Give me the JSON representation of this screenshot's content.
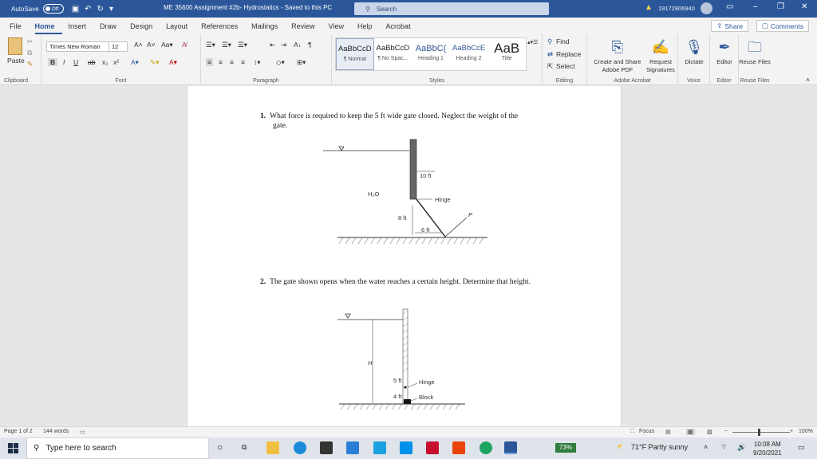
{
  "titlebar": {
    "autosave_label": "AutoSave",
    "autosave_state": "Off",
    "doc_title": "ME 35600 Assignment #2b- Hydrostatics  -  Saved to this PC",
    "search_placeholder": "Search",
    "phone": "19172806940",
    "accent": "#2b579a"
  },
  "menu": {
    "tabs": [
      "File",
      "Home",
      "Insert",
      "Draw",
      "Design",
      "Layout",
      "References",
      "Mailings",
      "Review",
      "View",
      "Help",
      "Acrobat"
    ],
    "active": "Home",
    "share": "Share",
    "comments": "Comments"
  },
  "ribbon": {
    "clipboard": {
      "paste": "Paste",
      "label": "Clipboard"
    },
    "font": {
      "family": "Times New Roman",
      "size": "12",
      "label": "Font"
    },
    "paragraph": {
      "label": "Paragraph"
    },
    "styles": {
      "label": "Styles",
      "items": [
        {
          "preview": "AaBbCcD",
          "name": "¶ Normal"
        },
        {
          "preview": "AaBbCcD",
          "name": "¶ No Spac..."
        },
        {
          "preview": "AaBbC(",
          "name": "Heading 1"
        },
        {
          "preview": "AaBbCcE",
          "name": "Heading 2"
        },
        {
          "preview": "AaB",
          "name": "Title"
        }
      ]
    },
    "editing": {
      "find": "Find",
      "replace": "Replace",
      "select": "Select",
      "label": "Editing"
    },
    "acrobat": {
      "create": "Create and Share Adobe PDF",
      "request": "Request Signatures",
      "label": "Adobe Acrobat"
    },
    "voice": {
      "dictate": "Dictate",
      "label": "Voice"
    },
    "editor": {
      "editor": "Editor",
      "label": "Editor"
    },
    "reuse": {
      "button": "Reuse Files",
      "label": "Reuse Files"
    }
  },
  "document": {
    "q1": {
      "number": "1.",
      "text": "What force is required to keep the 5 ft wide gate closed. Neglect the weight of the",
      "text2": "gate.",
      "labels": {
        "height": "10 ft",
        "fluid": "H₂O",
        "hinge": "Hinge",
        "depth": "8 ft",
        "width": "6 ft",
        "force": "P"
      }
    },
    "q2": {
      "number": "2.",
      "text": "The gate shown opens when the water reaches a certain height. Determine that height.",
      "labels": {
        "height": "H",
        "upper": "5 ft",
        "lower": "4 ft",
        "hinge": "Hinge",
        "block": "Block"
      }
    }
  },
  "statusbar": {
    "page": "Page 1 of 2",
    "words": "144 words",
    "focus": "Focus",
    "zoom": "100%"
  },
  "taskbar": {
    "search": "Type here to search",
    "battery": "73%",
    "weather": "71°F  Partly sunny",
    "time": "10:08 AM",
    "date": "9/20/2021"
  }
}
